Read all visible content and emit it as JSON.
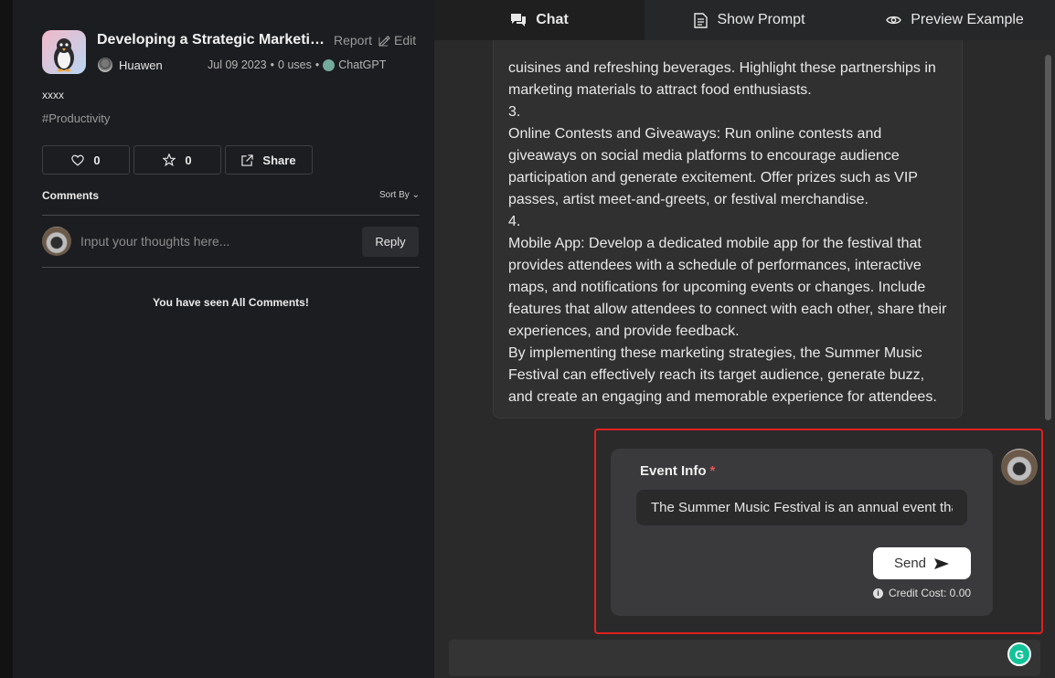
{
  "prompt": {
    "title": "Developing a Strategic Marketing Plan for the Summer Music Festival",
    "report_label": "Report",
    "edit_label": "Edit",
    "author": "Huawen",
    "date": "Jul 09 2023",
    "uses": "0 uses",
    "model": "ChatGPT",
    "description": "xxxx",
    "tag": "#Productivity"
  },
  "stats": {
    "likes": "0",
    "favorites": "0",
    "share_label": "Share"
  },
  "comments": {
    "label": "Comments",
    "sort_label": "Sort By",
    "input_placeholder": "Input your thoughts here...",
    "reply_label": "Reply",
    "seen_all": "You have seen All Comments!"
  },
  "tabs": [
    {
      "label": "Chat",
      "icon": "chat-icon",
      "active": true
    },
    {
      "label": "Show Prompt",
      "icon": "document-icon",
      "active": false
    },
    {
      "label": "Preview Example",
      "icon": "eye-icon",
      "active": false
    }
  ],
  "message": {
    "lines": [
      "cuisines and refreshing beverages. Highlight these partnerships in marketing materials to attract food enthusiasts.",
      "3.",
      "Online Contests and Giveaways: Run online contests and giveaways on social media platforms to encourage audience participation and generate excitement. Offer prizes such as VIP passes, artist meet-and-greets, or festival merchandise.",
      "4.",
      "Mobile App: Develop a dedicated mobile app for the festival that provides attendees with a schedule of performances, interactive maps, and notifications for upcoming events or changes. Include features that allow attendees to connect with each other, share their experiences, and provide feedback.",
      "By implementing these marketing strategies, the Summer Music Festival can effectively reach its target audience, generate buzz, and create an engaging and memorable experience for attendees."
    ]
  },
  "form": {
    "field_label": "Event Info",
    "required_mark": "*",
    "field_value": "The Summer Music Festival is an annual event that",
    "send_label": "Send",
    "credit_cost": "Credit Cost: 0.00"
  },
  "colors": {
    "highlight": "#e02020",
    "required": "#e25555",
    "chatgpt": "#74aa9c"
  }
}
